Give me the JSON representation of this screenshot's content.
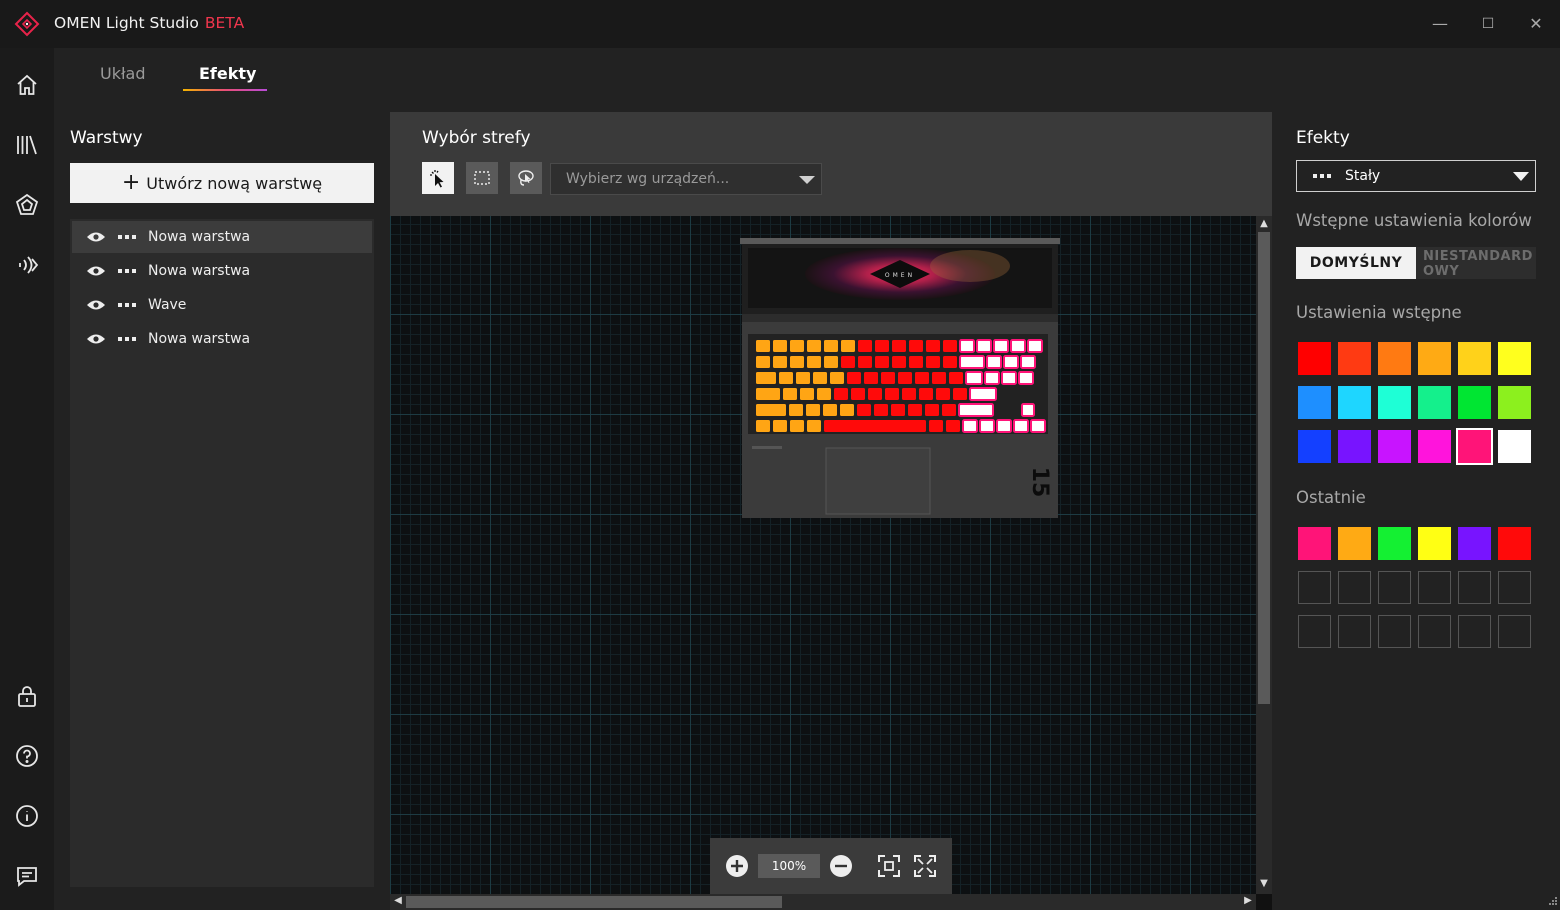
{
  "window": {
    "app_name": "OMEN Light Studio",
    "beta_label": "BETA",
    "minimize": "—",
    "maximize": "☐",
    "close": "✕"
  },
  "rail": {
    "items": [
      "home-icon",
      "library-icon",
      "effects-icon",
      "audio-wave-icon",
      "lock-icon",
      "help-icon",
      "info-icon",
      "feedback-icon"
    ]
  },
  "tabs": [
    {
      "label": "Układ",
      "active": false
    },
    {
      "label": "Efekty",
      "active": true
    }
  ],
  "layers_panel": {
    "title": "Warstwy",
    "new_layer_button": "Utwórz nową warstwę",
    "layers": [
      {
        "name": "Nowa warstwa",
        "selected": true
      },
      {
        "name": "Nowa warstwa",
        "selected": false
      },
      {
        "name": "Wave",
        "selected": false
      },
      {
        "name": "Nowa warstwa",
        "selected": false
      }
    ]
  },
  "zone_panel": {
    "title": "Wybór strefy",
    "tools": [
      "pointer-select-icon",
      "rectangle-select-icon",
      "lasso-select-icon"
    ],
    "device_select_placeholder": "Wybierz wg urządzeń...",
    "zoom_value": "100%",
    "device_logo_text": "OMEN",
    "device_model_text": "15"
  },
  "effects_panel": {
    "title": "Efekty",
    "effect_selected": "Stały",
    "color_presets_label": "Wstępne ustawienia kolorów",
    "toggle_default": "DOMYŚLNY",
    "toggle_custom": "NIESTANDARDOWY",
    "toggle_custom_line1": "NIESTANDARD",
    "toggle_custom_line2": "OWY",
    "presets_label": "Ustawienia wstępne",
    "preset_colors": [
      "#ff0000",
      "#ff3a12",
      "#ff7a12",
      "#ffaa14",
      "#ffd21a",
      "#ffff1e",
      "#1e8fff",
      "#1ed6ff",
      "#1effd6",
      "#14f08c",
      "#00e632",
      "#8cf01e",
      "#1440ff",
      "#7814ff",
      "#c814ff",
      "#ff14dc",
      "#ff1478",
      "#ffffff"
    ],
    "selected_preset_index": 16,
    "recent_label": "Ostatnie",
    "recent_colors": [
      "#ff1478",
      "#ffaa14",
      "#14f032",
      "#ffff14",
      "#7814ff",
      "#ff0a0a"
    ],
    "recent_empty_slots": 12
  }
}
